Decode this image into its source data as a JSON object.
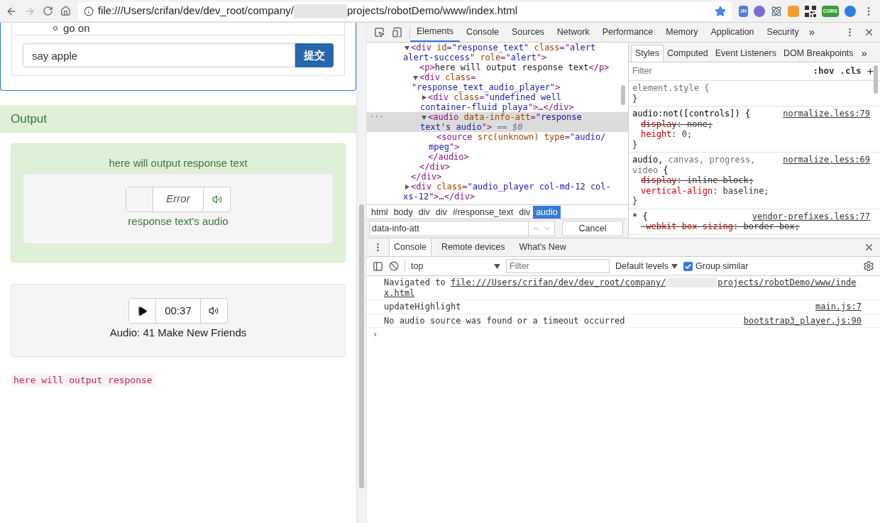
{
  "browser": {
    "url_parts": [
      {
        "kind": "text",
        "text": "file:///Users/crifan/dev/dev_root/company/"
      },
      {
        "kind": "redacted"
      },
      {
        "kind": "text",
        "text": "projects/robotDemo/www/index.html"
      }
    ],
    "bookmarked": true,
    "extensions": [
      {
        "kind": "text",
        "text": "JH",
        "color": "#4a7fd6"
      },
      {
        "kind": "circle",
        "color": "#7a6fd1"
      },
      {
        "kind": "atom",
        "color": "#5a6b7b"
      },
      {
        "kind": "square",
        "color": "#f0a030"
      },
      {
        "kind": "qr",
        "color": "#333333"
      },
      {
        "kind": "text",
        "text": "CORS",
        "color": "#3f9a3a"
      },
      {
        "kind": "circle",
        "color": "#2a7fe0"
      }
    ]
  },
  "page": {
    "list_item": "go on",
    "input_value": "say apple",
    "submit": "提交",
    "output_heading": "Output",
    "alert_text": "here will output response text",
    "players": [
      {
        "playable": false,
        "time": "Error",
        "error": true,
        "caption": "response text's audio"
      },
      {
        "playable": true,
        "time": "00:37",
        "error": false,
        "caption": "Audio: 41 Make New Friends"
      }
    ],
    "code": "here will output response"
  },
  "devtools": {
    "tabs": [
      {
        "label": "Elements",
        "selected": true
      },
      {
        "label": "Console",
        "selected": false
      },
      {
        "label": "Sources",
        "selected": false
      },
      {
        "label": "Network",
        "selected": false
      },
      {
        "label": "Performance",
        "selected": false
      },
      {
        "label": "Memory",
        "selected": false
      },
      {
        "label": "Application",
        "selected": false
      },
      {
        "label": "Security",
        "selected": false
      }
    ],
    "more": "»",
    "tree": [
      {
        "expanded": true,
        "selected": false,
        "lines": [
          "<div id=\"response_text\" class=\"alert",
          "alert-success\" role=\"alert\">"
        ],
        "close": "</div>",
        "children": [
          {
            "selected": false,
            "lines": [
              "<p>here will output response text</p>"
            ]
          },
          {
            "expanded": true,
            "selected": false,
            "lines": [
              "<div class=",
              "\"response_text_audio_player\">"
            ],
            "close": "</div>",
            "children": [
              {
                "expanded": false,
                "selected": false,
                "lines": [
                  "<div class=\"undefined well",
                  "container-fluid playa\">…</div>"
                ]
              },
              {
                "expanded": true,
                "selected": true,
                "gutter": "···",
                "marker": "== $0",
                "lines": [
                  "<audio data-info-att=\"response",
                  "text's audio\">"
                ],
                "close": "</audio>",
                "children": [
                  {
                    "selected": false,
                    "lines": [
                      "<source src(unknown) type=\"audio/",
                      "mpeg\">"
                    ]
                  }
                ]
              }
            ]
          }
        ]
      },
      {
        "expanded": false,
        "selected": false,
        "lines": [
          "<div class=\"audio_player col-md-12 col-",
          "xs-12\">…</div>"
        ]
      }
    ],
    "breadcrumbs": [
      {
        "label": "html",
        "selected": false
      },
      {
        "label": "body",
        "selected": false
      },
      {
        "label": "div",
        "selected": false
      },
      {
        "label": "div",
        "selected": false
      },
      {
        "label": "#response_text",
        "selected": false
      },
      {
        "label": "div",
        "selected": false
      },
      {
        "label": "audio",
        "selected": true
      }
    ],
    "search_value": "data-info-att",
    "cancel": "Cancel",
    "style_tabs": [
      {
        "label": "Styles",
        "selected": true
      },
      {
        "label": "Computed",
        "selected": false
      },
      {
        "label": "Event Listeners",
        "selected": false
      },
      {
        "label": "DOM Breakpoints",
        "selected": false
      }
    ],
    "styles_filter": "Filter",
    "hov": ":hov",
    "cls": ".cls",
    "add": "+",
    "rules": [
      {
        "selector": [
          {
            "t": "element.style {",
            "dim": true
          }
        ],
        "close": "}"
      },
      {
        "selector": [
          {
            "t": "audio:not([controls]) {",
            "dim": false
          }
        ],
        "source": "normalize.less:79",
        "props": [
          {
            "text": "display: none;",
            "struck": true
          },
          {
            "text": "height: 0;",
            "struck": false
          }
        ],
        "close": "}"
      },
      {
        "selector": [
          {
            "t": "audio,",
            "dim": false
          },
          {
            "t": " canvas, progress,",
            "dim": true
          },
          {
            "t": "video",
            "dim": true
          },
          {
            "t": " {",
            "dim": false
          }
        ],
        "source": "normalize.less:69",
        "props": [
          {
            "text": "display: inline-block;",
            "struck": true
          },
          {
            "text": "vertical-align: baseline;",
            "struck": false
          }
        ],
        "close": "}"
      },
      {
        "selector": [
          {
            "t": "* {",
            "dim": false
          }
        ],
        "source": "vendor-prefixes.less:77",
        "props": [
          {
            "text": "-webkit-box-sizing: border-box;",
            "struck": true
          }
        ]
      }
    ],
    "drawer_tabs": [
      {
        "label": "Console",
        "selected": true
      },
      {
        "label": "Remote devices",
        "selected": false
      },
      {
        "label": "What's New",
        "selected": false
      }
    ],
    "context": "top",
    "console_filter": "Filter",
    "levels": "Default levels",
    "group_similar": {
      "label": "Group similar",
      "checked": true
    },
    "messages": [
      {
        "parts": [
          {
            "kind": "text",
            "text": "Navigated to "
          },
          {
            "kind": "link",
            "text": "file:///Users/crifan/dev/dev_root/company/"
          },
          {
            "kind": "redacted"
          },
          {
            "kind": "link",
            "text": "projects/robotDemo/www/inde"
          },
          {
            "kind": "link",
            "text": "x.html"
          }
        ]
      },
      {
        "parts": [
          {
            "kind": "text",
            "text": "updateHighlight"
          }
        ],
        "source": "main.js:7"
      },
      {
        "parts": [
          {
            "kind": "text",
            "text": "No audio source was found or a timeout occurred"
          }
        ],
        "source": "bootstrap3_player.js:90"
      }
    ],
    "prompt": "›"
  }
}
